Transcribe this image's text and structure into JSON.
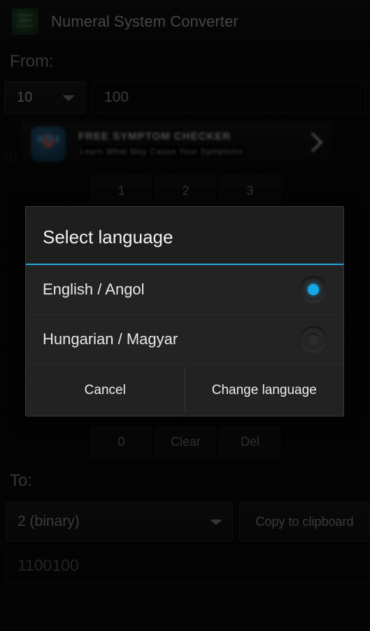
{
  "titlebar": {
    "app_title": "Numeral System Converter",
    "icon_text_line1": "Numeral",
    "icon_text_line2": "System",
    "icon_text_line3": "Converter"
  },
  "from_section": {
    "label": "From:",
    "base_value": "10",
    "number_value": "100"
  },
  "ad": {
    "headline": "FREE SYMPTOM CHECKER",
    "subline": "Learn What May Cause Your Symptoms",
    "info_glyph": "i",
    "arrow_glyph": "›"
  },
  "keypad": {
    "row1": [
      "1",
      "2",
      "3"
    ],
    "row4": [
      "0",
      "Clear",
      "Del"
    ]
  },
  "to_section": {
    "label": "To:",
    "base_value": "2 (binary)",
    "copy_button": "Copy to clipboard",
    "output_value": "1100100"
  },
  "dialog": {
    "title": "Select language",
    "options": [
      {
        "label": "English / Angol",
        "selected": true
      },
      {
        "label": "Hungarian / Magyar",
        "selected": false
      }
    ],
    "cancel_label": "Cancel",
    "confirm_label": "Change language"
  },
  "colors": {
    "accent": "#2aa5db",
    "radio_selected": "#15a8e8",
    "dialog_background": "#1e1e1e",
    "app_background": "#0a0a0a"
  }
}
